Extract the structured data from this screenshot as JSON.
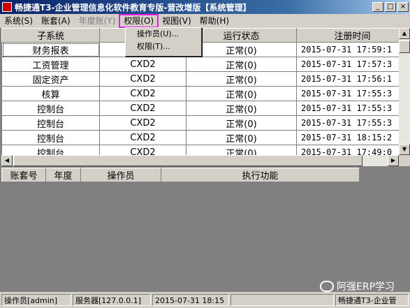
{
  "window": {
    "title": "畅捷通T3-企业管理信息化软件教育专版-营改增版【系统管理】",
    "minimize": "_",
    "maximize": "□",
    "close": "×"
  },
  "menu": {
    "items": [
      "系统(S)",
      "账套(A)",
      "年度账(Y)",
      "权限(O)",
      "视图(V)",
      "帮助(H)"
    ]
  },
  "dropdown": {
    "items": [
      "操作员(U)...",
      "权限(T)..."
    ]
  },
  "top_grid": {
    "headers": [
      "子系统",
      "",
      "运行状态",
      "注册时间"
    ],
    "rows": [
      [
        "财务报表",
        "",
        "正常(0)",
        "2015-07-31 17:59:1"
      ],
      [
        "工资管理",
        "CXD2",
        "正常(0)",
        "2015-07-31 17:57:3"
      ],
      [
        "固定资产",
        "CXD2",
        "正常(0)",
        "2015-07-31 17:56:1"
      ],
      [
        "核算",
        "CXD2",
        "正常(0)",
        "2015-07-31 17:55:3"
      ],
      [
        "控制台",
        "CXD2",
        "正常(0)",
        "2015-07-31 17:55:3"
      ],
      [
        "控制台",
        "CXD2",
        "正常(0)",
        "2015-07-31 17:55:3"
      ],
      [
        "控制台",
        "CXD2",
        "正常(0)",
        "2015-07-31 18:15:2"
      ],
      [
        "控制台",
        "CXD2",
        "正常(0)",
        "2015-07-31 17:49:0"
      ]
    ]
  },
  "bottom_grid": {
    "headers": [
      "账套号",
      "年度",
      "操作员",
      "执行功能"
    ]
  },
  "status": {
    "operator": "操作员[admin]",
    "server": "服务器[127.0.0.1]",
    "datetime": "2015-07-31 18:15",
    "product": "畅捷通T3-企业管"
  },
  "watermark": {
    "text": "阿强ERP学习"
  },
  "colors": {
    "title_start": "#0a246a",
    "highlight_outline": "#e020e0",
    "face": "#d4d0c8",
    "workspace": "#808080"
  }
}
